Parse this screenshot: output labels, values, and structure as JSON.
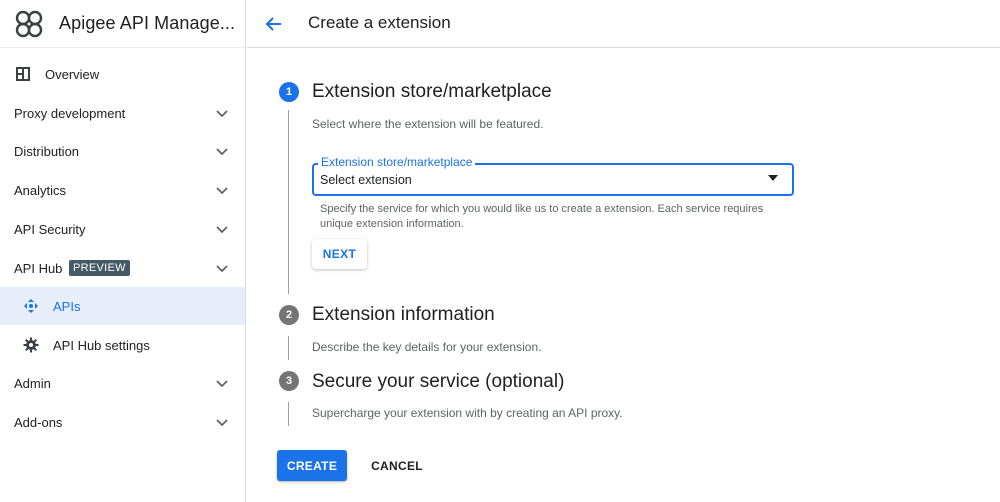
{
  "app": {
    "title": "Apigee API Manage..."
  },
  "header": {
    "title": "Create a extension"
  },
  "sidebar": {
    "items": [
      {
        "label": "Overview"
      },
      {
        "label": "Proxy development"
      },
      {
        "label": "Distribution"
      },
      {
        "label": "Analytics"
      },
      {
        "label": "API Security"
      },
      {
        "label": "API Hub",
        "badge": "PREVIEW"
      },
      {
        "label": "APIs"
      },
      {
        "label": "API Hub settings"
      },
      {
        "label": "Admin"
      },
      {
        "label": "Add-ons"
      }
    ]
  },
  "steps": [
    {
      "number": "1",
      "title": "Extension store/marketplace",
      "description": "Select where the extension will be featured."
    },
    {
      "number": "2",
      "title": "Extension information",
      "description": "Describe the key details for your extension."
    },
    {
      "number": "3",
      "title": "Secure your service (optional)",
      "description": "Supercharge your extension with by creating an API proxy."
    }
  ],
  "form": {
    "select_label": "Extension store/marketplace",
    "select_value": "Select extension",
    "helper_line1": "Specify the service for which you would like us to create a extension. Each service requires",
    "helper_line2": "unique extension information.",
    "next_label": "NEXT"
  },
  "actions": {
    "create_label": "CREATE",
    "cancel_label": "CANCEL"
  },
  "colors": {
    "accent": "#1a73e8",
    "active_nav_bg": "#e8eef9",
    "badge_bg": "#455a64"
  }
}
